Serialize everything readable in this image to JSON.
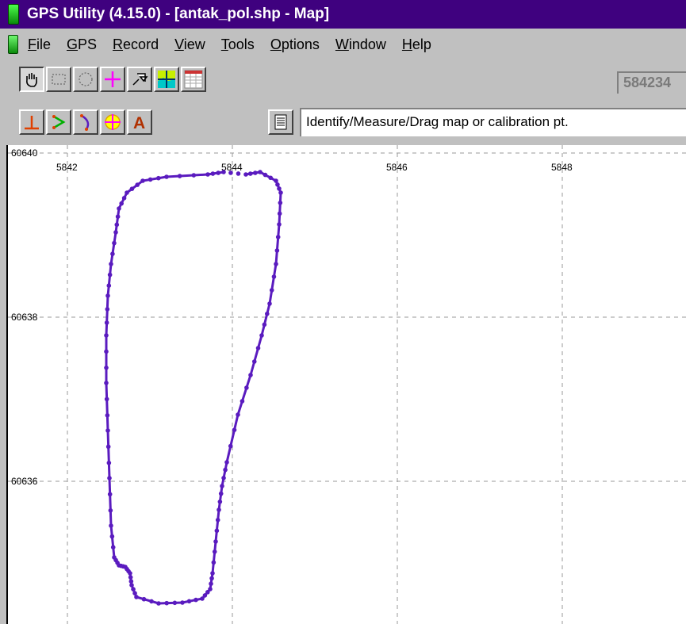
{
  "window": {
    "title": "GPS Utility (4.15.0) - [antak_pol.shp - Map]"
  },
  "menu": [
    {
      "u": "F",
      "rest": "ile"
    },
    {
      "u": "G",
      "rest": "PS"
    },
    {
      "u": "R",
      "rest": "ecord"
    },
    {
      "u": "V",
      "rest": "iew"
    },
    {
      "u": "T",
      "rest": "ools"
    },
    {
      "u": "O",
      "rest": "ptions"
    },
    {
      "u": "W",
      "rest": "indow"
    },
    {
      "u": "H",
      "rest": "elp"
    }
  ],
  "toolbar": {
    "coord_display": "584234",
    "status_text": "Identify/Measure/Drag map or calibration pt.",
    "row1": [
      "hand-icon",
      "rectangle-select-icon",
      "circle-select-icon",
      "crosshair-icon",
      "map-nav-icon",
      "map-color-icon",
      "grid-table-icon"
    ],
    "row2": [
      "perpendicular-icon",
      "angle-icon",
      "arc-icon",
      "target-icon",
      "text-tool-icon"
    ]
  },
  "map": {
    "x_labels": [
      "5842",
      "5844",
      "5846",
      "5848"
    ],
    "y_labels": [
      "60640",
      "60638",
      "60636"
    ],
    "track_color": "#5a1bbf"
  }
}
